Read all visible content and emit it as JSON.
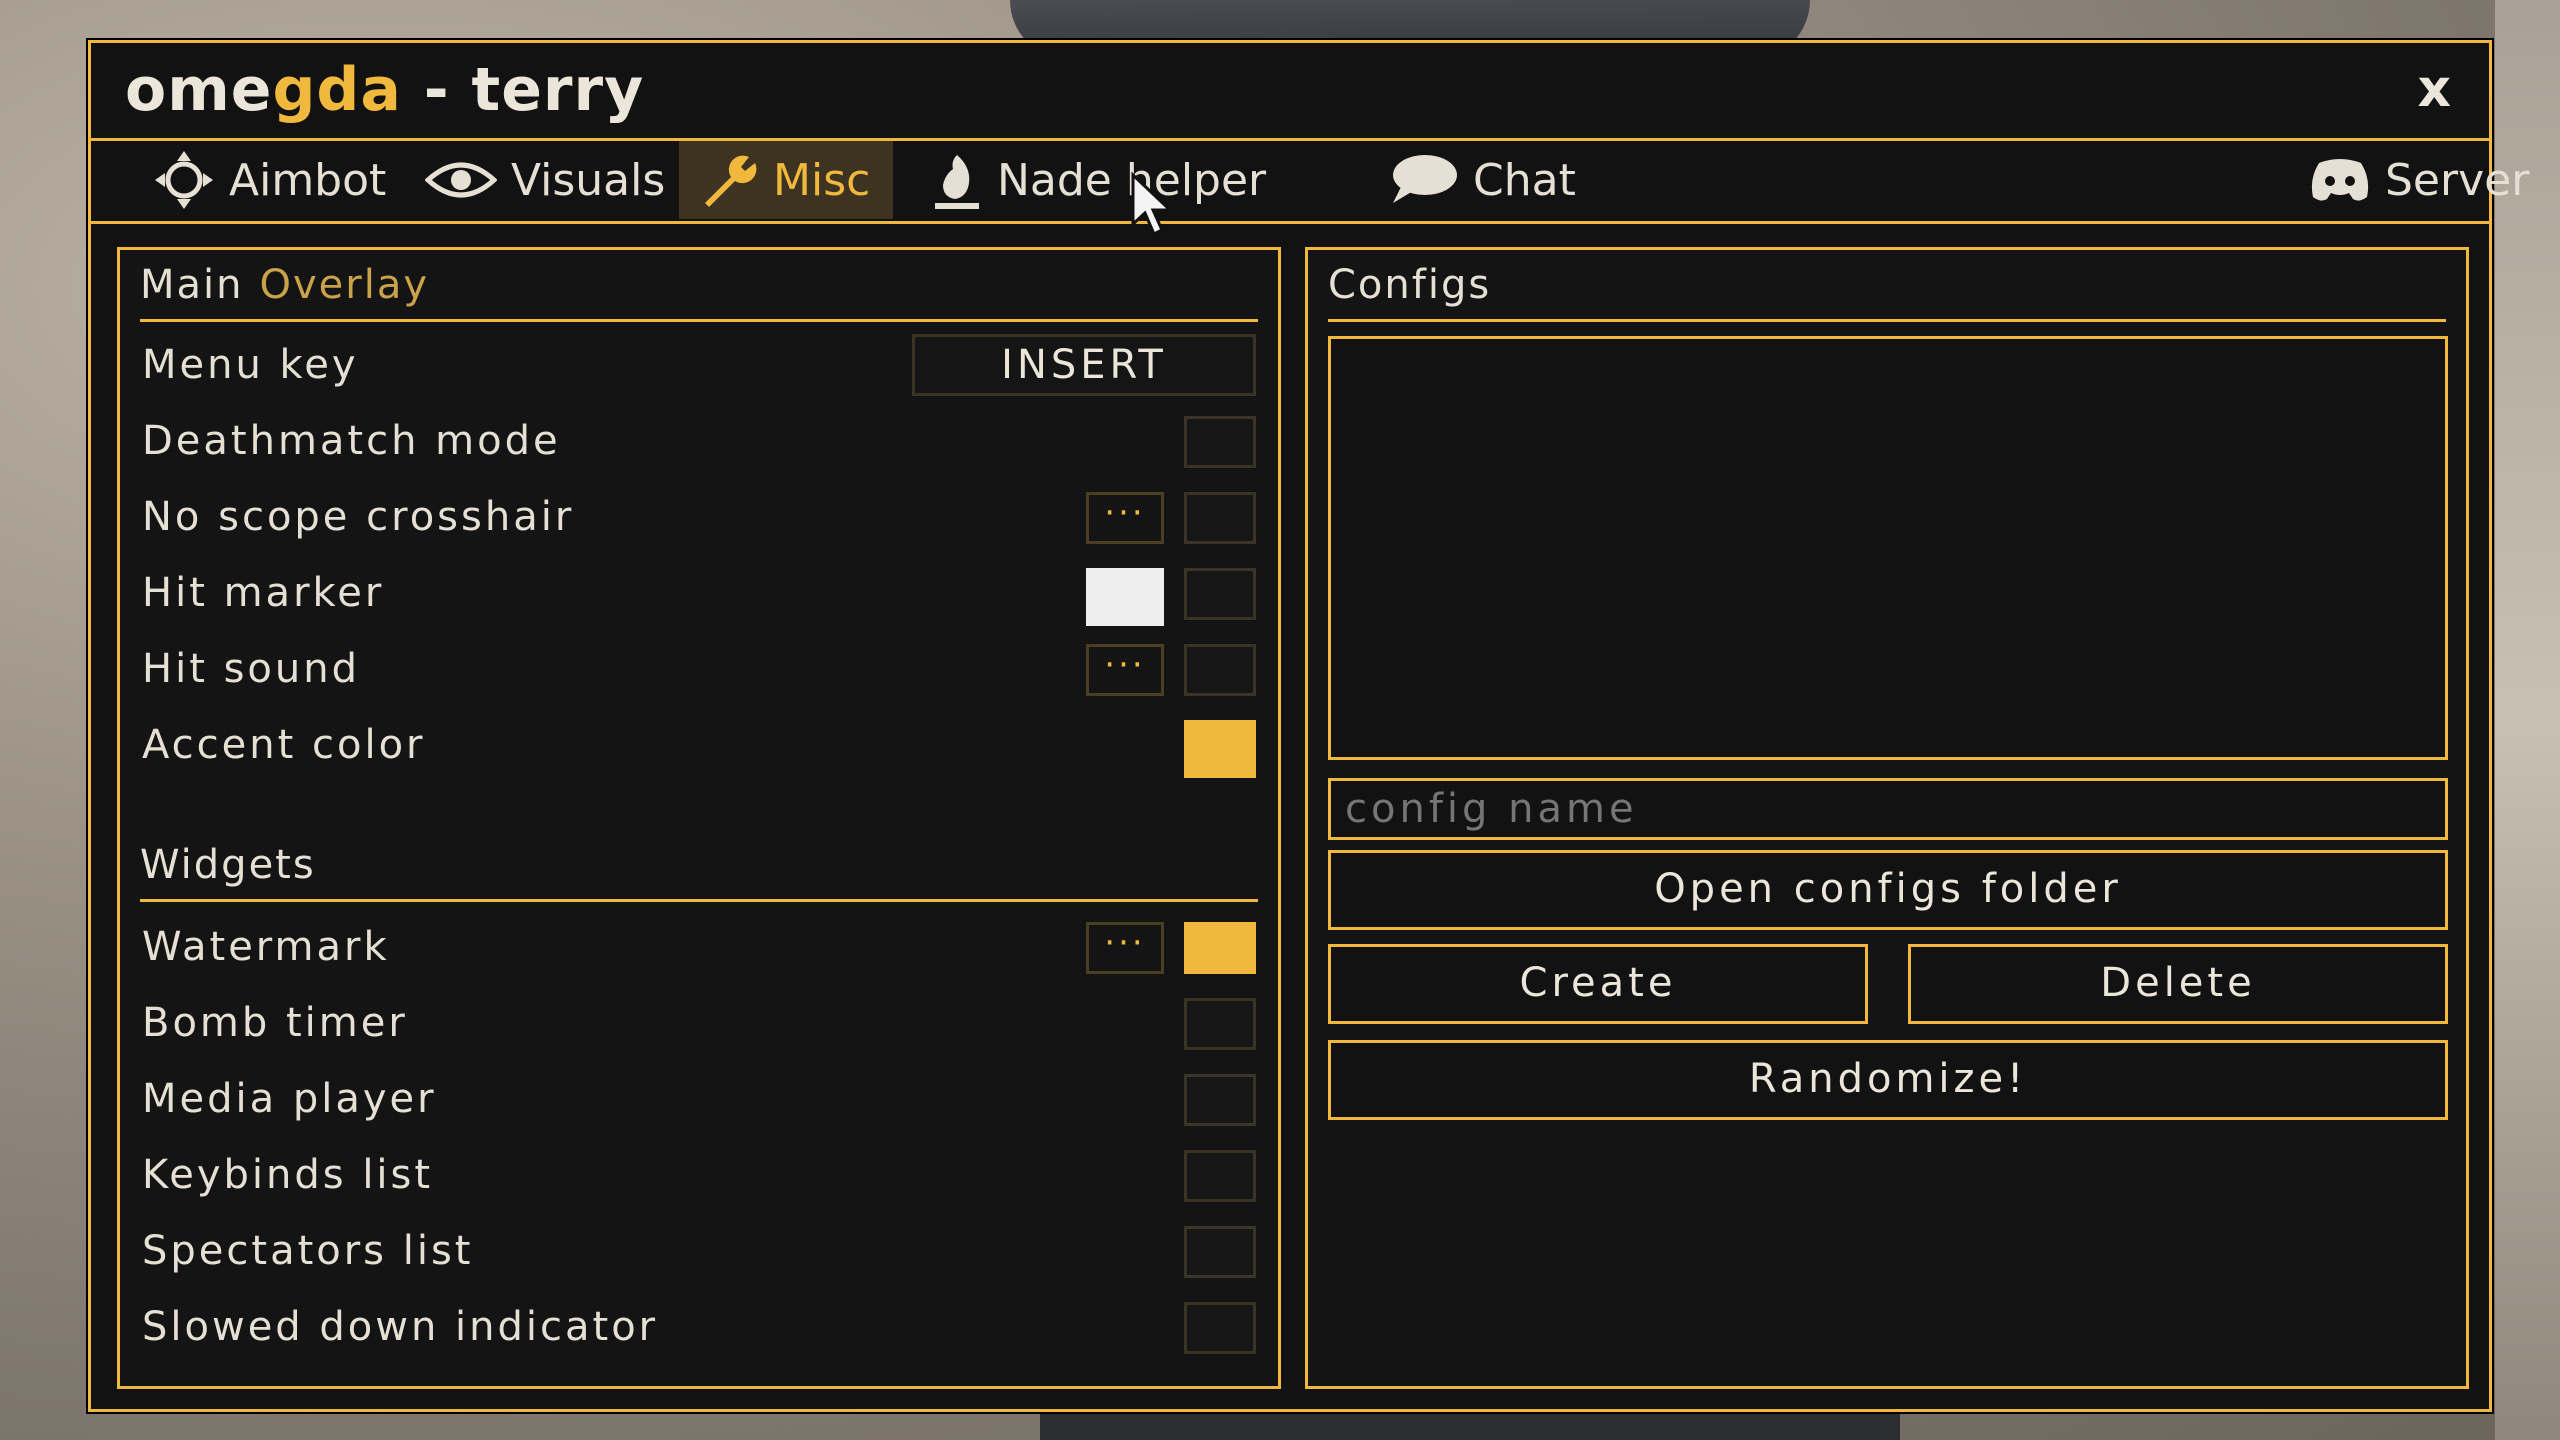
{
  "window": {
    "title_prefix": "ome",
    "title_accent": "gda",
    "title_suffix": " - terry",
    "close_label": "x"
  },
  "tabs": [
    {
      "label": "Aimbot",
      "icon": "crosshair-icon"
    },
    {
      "label": "Visuals",
      "icon": "eye-icon"
    },
    {
      "label": "Misc",
      "icon": "wrench-icon",
      "active": true
    },
    {
      "label": "Nade helper",
      "icon": "grenade-icon"
    },
    {
      "label": "Chat",
      "icon": "chat-bubble-icon"
    },
    {
      "label": "Server",
      "icon": "discord-icon"
    }
  ],
  "left_panel": {
    "header_main": "Main",
    "header_sub": "Overlay",
    "menu_key_label": "Menu key",
    "menu_key_value": "INSERT",
    "rows": {
      "deathmatch": "Deathmatch mode",
      "noscope": "No scope crosshair",
      "hitmarker": "Hit marker",
      "hitsound": "Hit sound",
      "accent": "Accent color"
    },
    "widgets_header": "Widgets",
    "widgets": {
      "watermark": "Watermark",
      "bomb": "Bomb timer",
      "media": "Media player",
      "keybinds": "Keybinds list",
      "spectators": "Spectators list",
      "slowed": "Slowed down indicator"
    },
    "options_label": "···"
  },
  "right_panel": {
    "header": "Configs",
    "config_name_placeholder": "config name",
    "open_folder": "Open configs folder",
    "create": "Create",
    "delete": "Delete",
    "randomize": "Randomize!"
  },
  "colors": {
    "accent": "#f0b93e",
    "background": "#121212",
    "hit_marker_color": "#eeeeee"
  }
}
